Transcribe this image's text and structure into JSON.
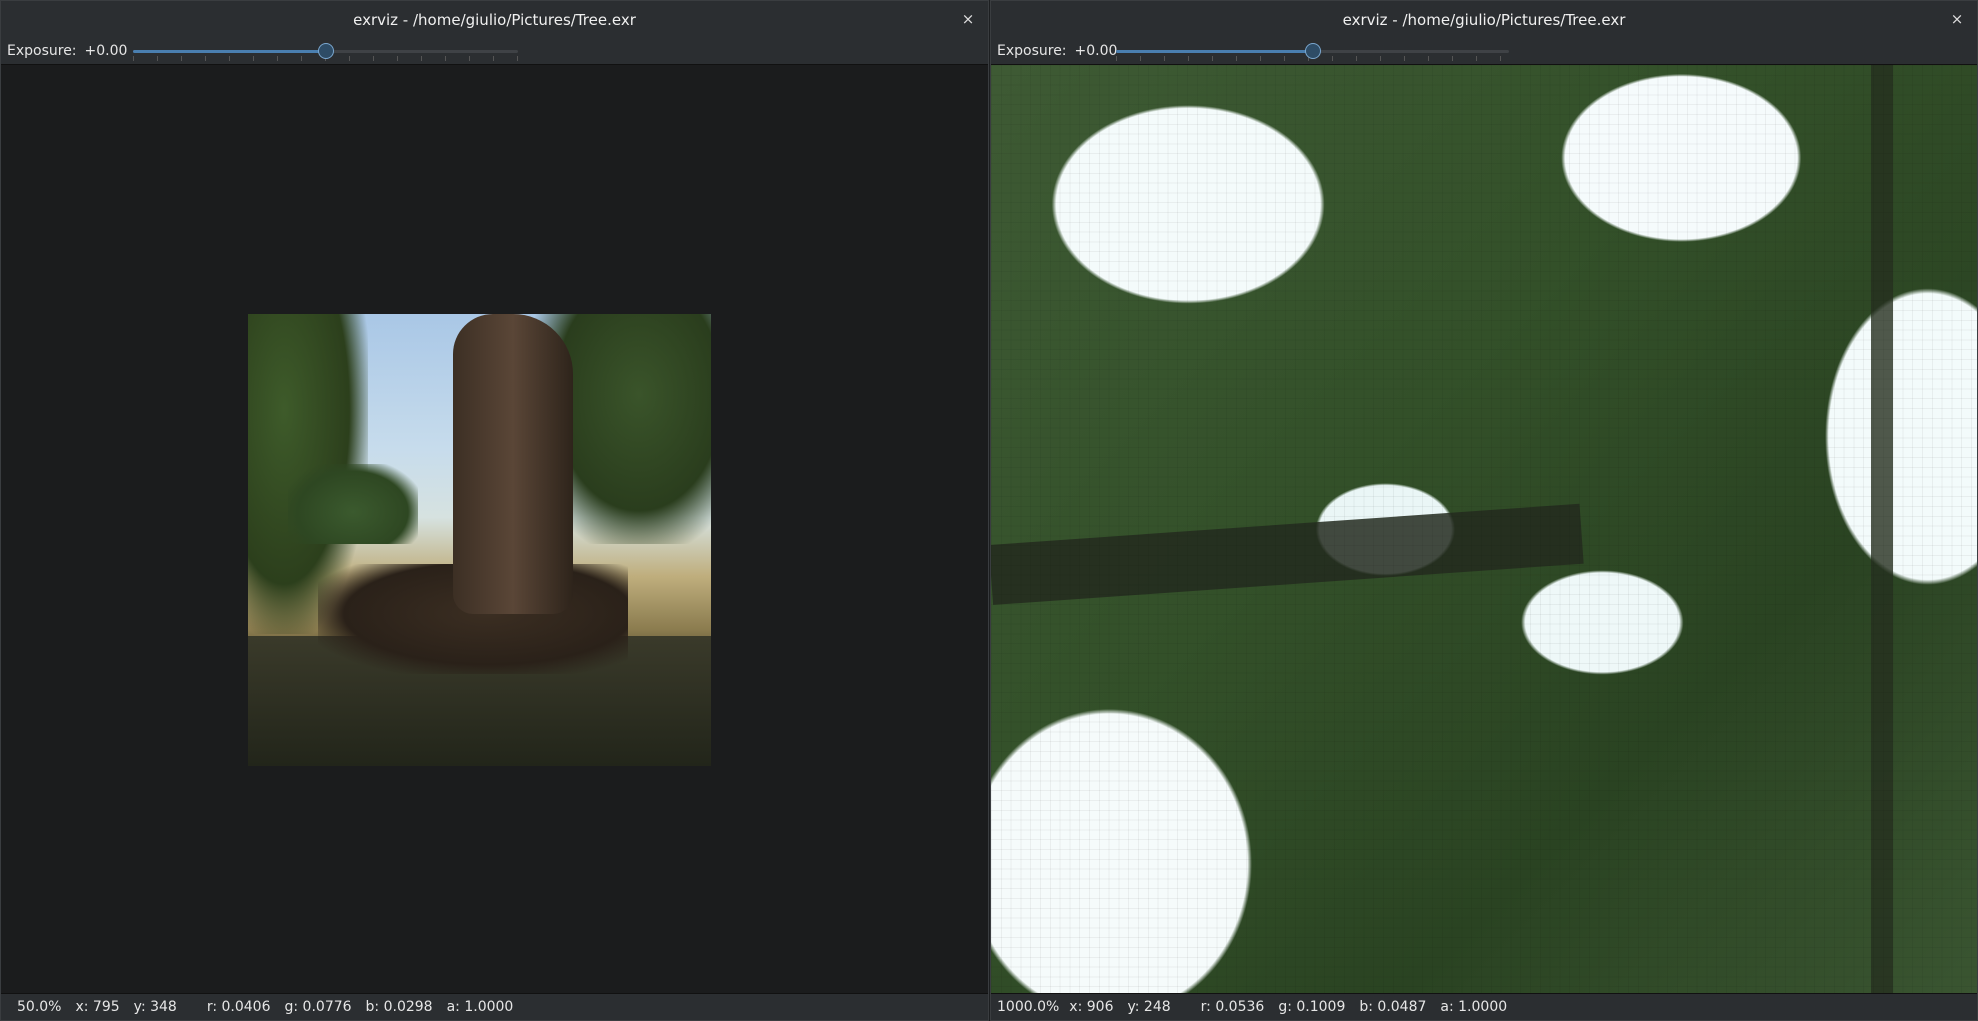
{
  "windows": [
    {
      "title": "exrviz - /home/giulio/Pictures/Tree.exr",
      "close_label": "×",
      "exposure_label": "Exposure:",
      "exposure_value": "+0.00",
      "slider_fraction": 0.5,
      "status": {
        "zoom": "50.0%",
        "x": "x: 795",
        "y": "y: 348",
        "r": "r: 0.0406",
        "g": "g: 0.0776",
        "b": "b: 0.0298",
        "a": "a: 1.0000"
      }
    },
    {
      "title": "exrviz - /home/giulio/Pictures/Tree.exr",
      "close_label": "×",
      "exposure_label": "Exposure:",
      "exposure_value": "+0.00",
      "slider_fraction": 0.5,
      "status": {
        "zoom": "1000.0%",
        "x": "x: 906",
        "y": "y: 248",
        "r": "r: 0.0536",
        "g": "g: 0.1009",
        "b": "b: 0.0487",
        "a": "a: 1.0000"
      }
    }
  ],
  "colors": {
    "accent": "#4a7fb0",
    "titlebar_bg": "#2b2e31",
    "viewport_bg": "#1b1c1d"
  },
  "icons": {
    "close": "close-icon"
  }
}
